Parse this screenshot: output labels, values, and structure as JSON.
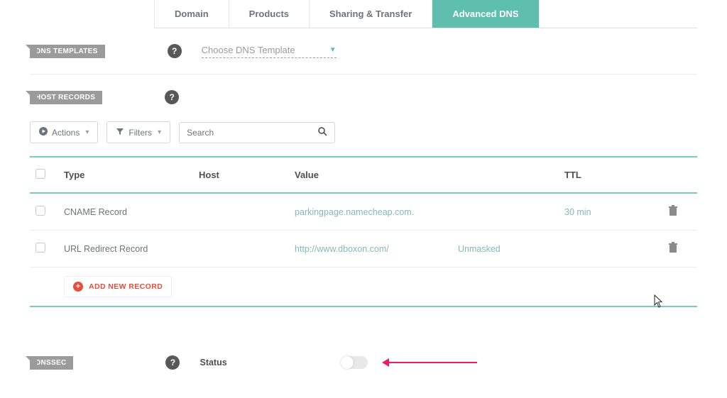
{
  "tabs": {
    "domain": "Domain",
    "products": "Products",
    "sharing": "Sharing & Transfer",
    "advanced_dns": "Advanced DNS"
  },
  "sections": {
    "dns_templates": "DNS TEMPLATES",
    "host_records": "HOST RECORDS",
    "dnssec": "DNSSEC"
  },
  "dns_template": {
    "placeholder": "Choose DNS Template"
  },
  "toolbar": {
    "actions": "Actions",
    "filters": "Filters",
    "search_placeholder": "Search"
  },
  "table": {
    "headers": {
      "type": "Type",
      "host": "Host",
      "value": "Value",
      "ttl": "TTL"
    },
    "rows": [
      {
        "type": "CNAME Record",
        "host": "",
        "value": "parkingpage.namecheap.com.",
        "mask": "",
        "ttl": "30 min"
      },
      {
        "type": "URL Redirect Record",
        "host": "",
        "value": "http://www.dboxon.com/",
        "mask": "Unmasked",
        "ttl": ""
      }
    ],
    "add_label": "ADD NEW RECORD"
  },
  "dnssec": {
    "status_label": "Status"
  },
  "help_glyph": "?"
}
